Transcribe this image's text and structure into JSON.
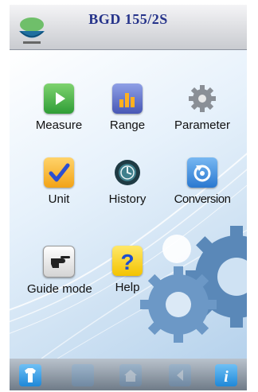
{
  "header": {
    "title": "BGD 155/2S"
  },
  "menu": {
    "measure": "Measure",
    "range": "Range",
    "parameter": "Parameter",
    "unit": "Unit",
    "history": "History",
    "conversion": "Conversion",
    "guide_mode": "Guide mode",
    "help": "Help"
  },
  "footer": {
    "icons": [
      "shirt-icon",
      "crop-icon",
      "home-icon",
      "back-icon",
      "info-icon"
    ],
    "info_glyph": "i"
  },
  "colors": {
    "title": "#25338a",
    "background": "#cfe2f3",
    "footer": "#6f7b88"
  }
}
